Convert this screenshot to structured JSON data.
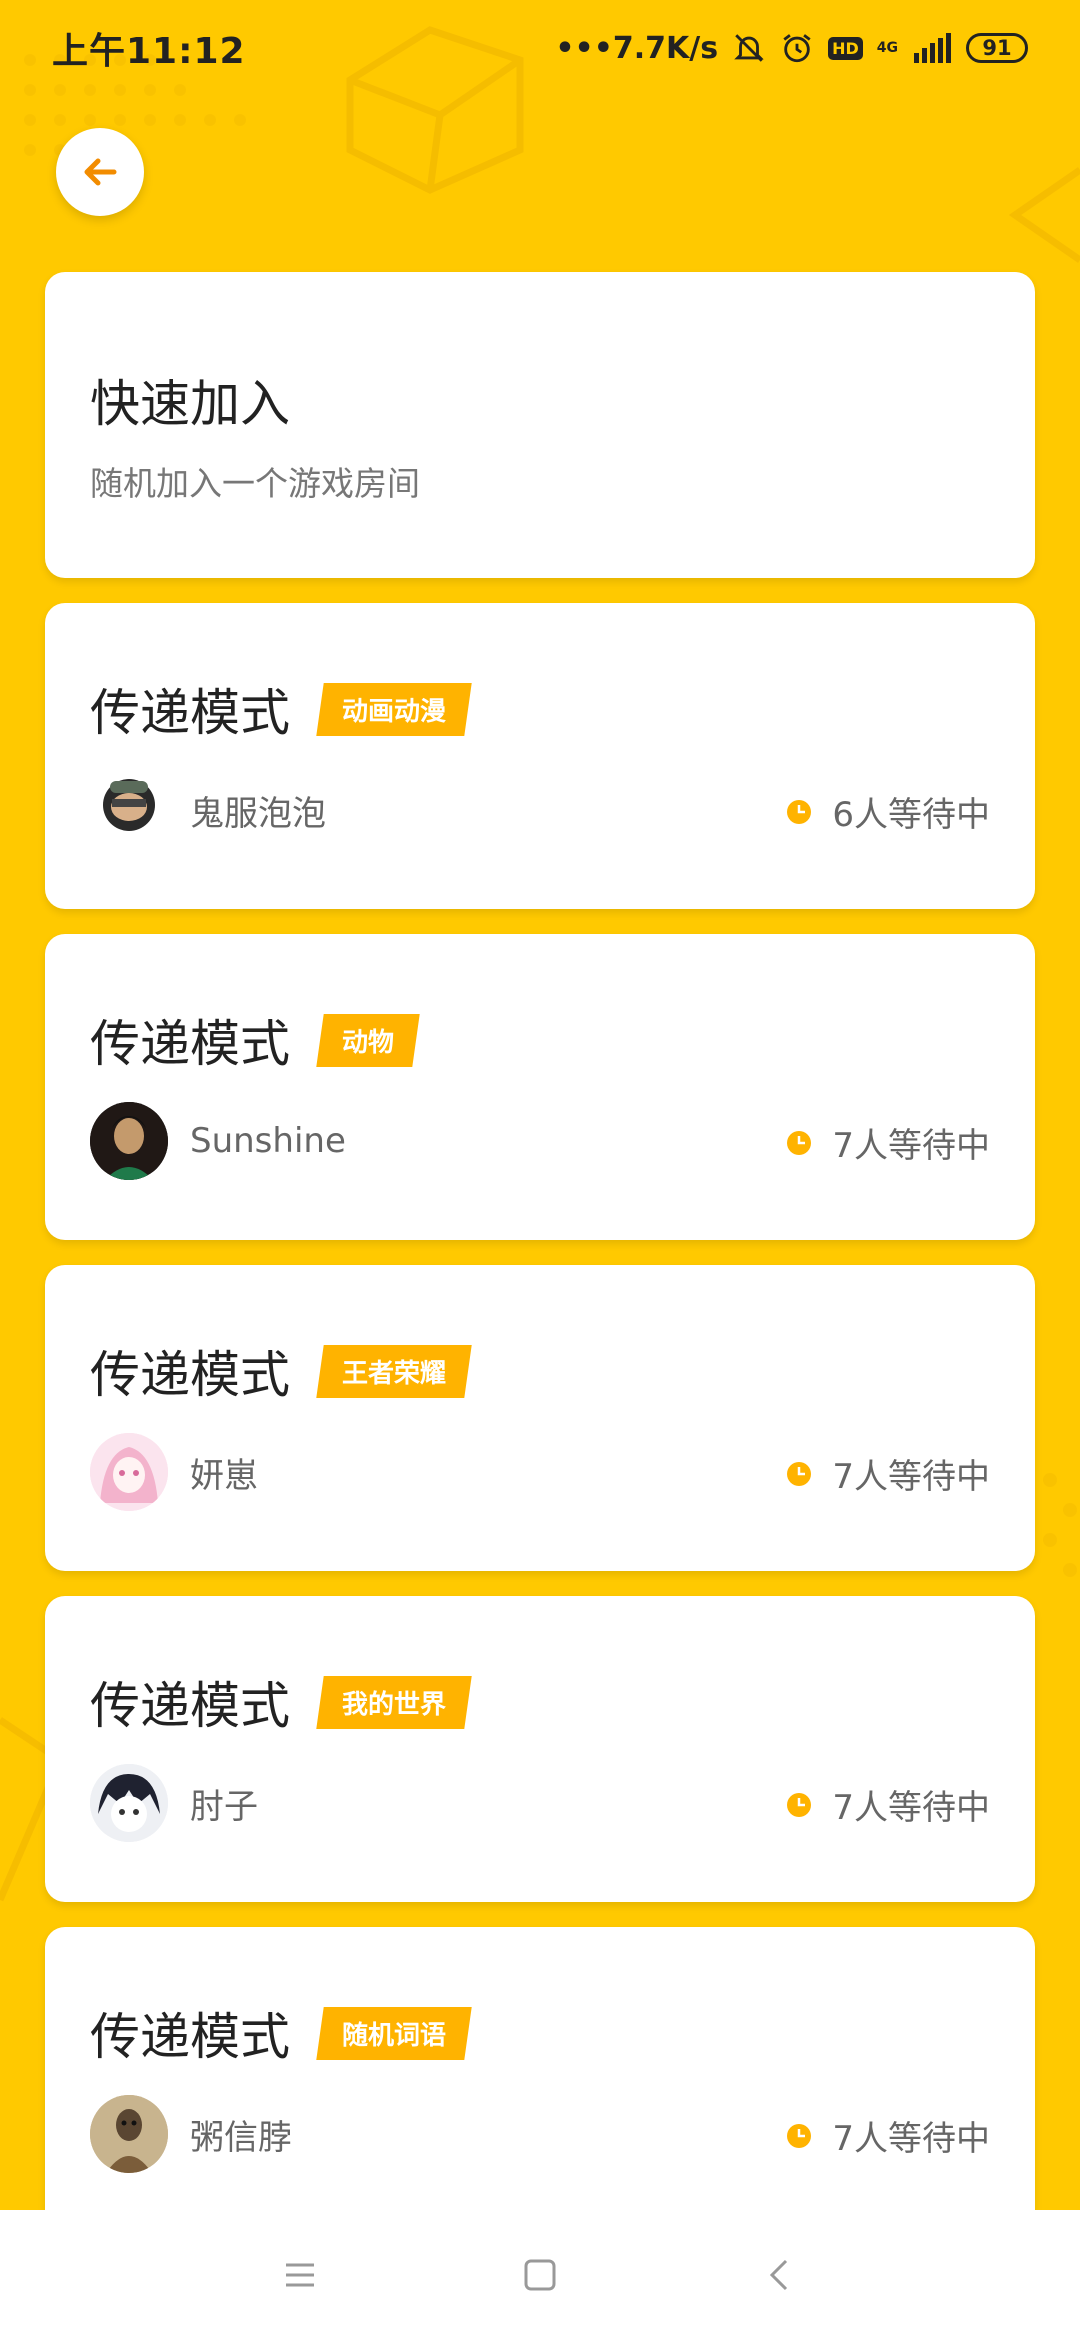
{
  "status_bar": {
    "time": "上午11:12",
    "network_speed": "•••7.7K/s",
    "hd_badge": "HD",
    "network_type": "4G",
    "battery": "91"
  },
  "quick_join": {
    "title": "快速加入",
    "subtitle": "随机加入一个游戏房间"
  },
  "rooms": [
    {
      "mode": "传递模式",
      "tag": "动画动漫",
      "user": "鬼服泡泡",
      "waiting": "6人等待中"
    },
    {
      "mode": "传递模式",
      "tag": "动物",
      "user": "Sunshine",
      "waiting": "7人等待中"
    },
    {
      "mode": "传递模式",
      "tag": "王者荣耀",
      "user": "妍崽",
      "waiting": "7人等待中"
    },
    {
      "mode": "传递模式",
      "tag": "我的世界",
      "user": "肘子",
      "waiting": "7人等待中"
    },
    {
      "mode": "传递模式",
      "tag": "随机词语",
      "user": "粥信脖",
      "waiting": "7人等待中"
    }
  ],
  "colors": {
    "background": "#FFC900",
    "accent": "#FFB300",
    "back_arrow": "#F28C00"
  },
  "icons": {
    "back": "arrow-left-icon",
    "clock": "clock-icon",
    "nav_menu": "menu-icon",
    "nav_home": "home-square-icon",
    "nav_back": "chevron-left-icon"
  }
}
